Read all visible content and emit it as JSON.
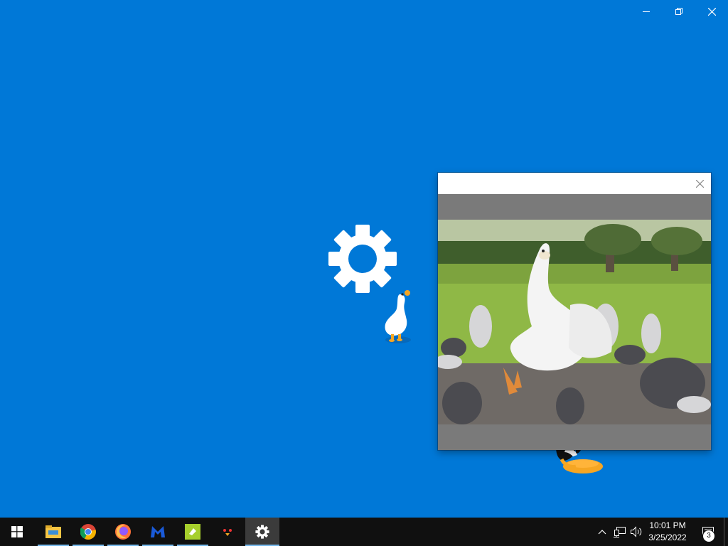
{
  "window": {
    "minimize_icon": "minimize-icon",
    "restore_icon": "restore-icon",
    "close_icon": "close-icon"
  },
  "loading": {
    "icon": "gear-icon"
  },
  "popup": {
    "close_icon": "close-icon",
    "image": "goose-with-pigeons-photo"
  },
  "taskbar": {
    "apps": [
      {
        "name": "start",
        "icon": "windows-logo-icon"
      },
      {
        "name": "file-explorer",
        "icon": "folder-icon"
      },
      {
        "name": "chrome",
        "icon": "chrome-icon"
      },
      {
        "name": "firefox",
        "icon": "firefox-icon"
      },
      {
        "name": "malwarebytes",
        "icon": "malwarebytes-icon"
      },
      {
        "name": "app",
        "icon": "green-app-icon"
      },
      {
        "name": "desktop-goose",
        "icon": "goose-icon"
      },
      {
        "name": "settings",
        "icon": "gear-icon"
      }
    ],
    "tray": {
      "time": "10:01 PM",
      "date": "3/25/2022",
      "notification_count": "3"
    }
  },
  "colors": {
    "desktop": "#0078d7",
    "taskbar": "#101010",
    "accent": "#76b9ed"
  }
}
